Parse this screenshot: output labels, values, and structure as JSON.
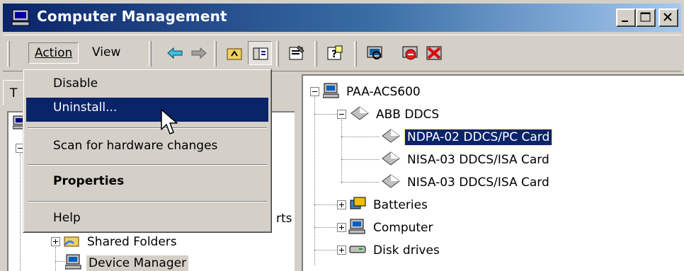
{
  "window": {
    "title": "Computer Management",
    "colors": {
      "titlebar_start": "#0a246a",
      "titlebar_end": "#a6caf0",
      "selection": "#0a246a",
      "face": "#d4d0c8"
    }
  },
  "menubar": {
    "action_label": "Action",
    "view_label": "View"
  },
  "toolbar": {
    "icons": [
      "back-icon",
      "forward-icon",
      "up-folder-icon",
      "show-hide-tree-icon",
      "properties-icon",
      "help-icon",
      "scan-hardware-icon",
      "disable-device-icon",
      "uninstall-device-icon"
    ]
  },
  "left_pane": {
    "tab_fragment": "T",
    "items": [
      {
        "label": "rts"
      },
      {
        "label": "Shared Folders"
      },
      {
        "label": "Device Manager"
      }
    ]
  },
  "context_menu": {
    "items": [
      {
        "label": "Disable"
      },
      {
        "label": "Uninstall..."
      },
      {
        "label": "Scan for hardware changes"
      },
      {
        "label": "Properties"
      },
      {
        "label": "Help"
      }
    ]
  },
  "device_tree": {
    "root": "PAA-ACS600",
    "group": "ABB DDCS",
    "children": [
      {
        "label": "NDPA-02 DDCS/PC Card"
      },
      {
        "label": "NISA-03 DDCS/ISA Card"
      },
      {
        "label": "NISA-03 DDCS/ISA Card"
      }
    ],
    "categories": [
      {
        "label": "Batteries"
      },
      {
        "label": "Computer"
      },
      {
        "label": "Disk drives"
      }
    ]
  }
}
